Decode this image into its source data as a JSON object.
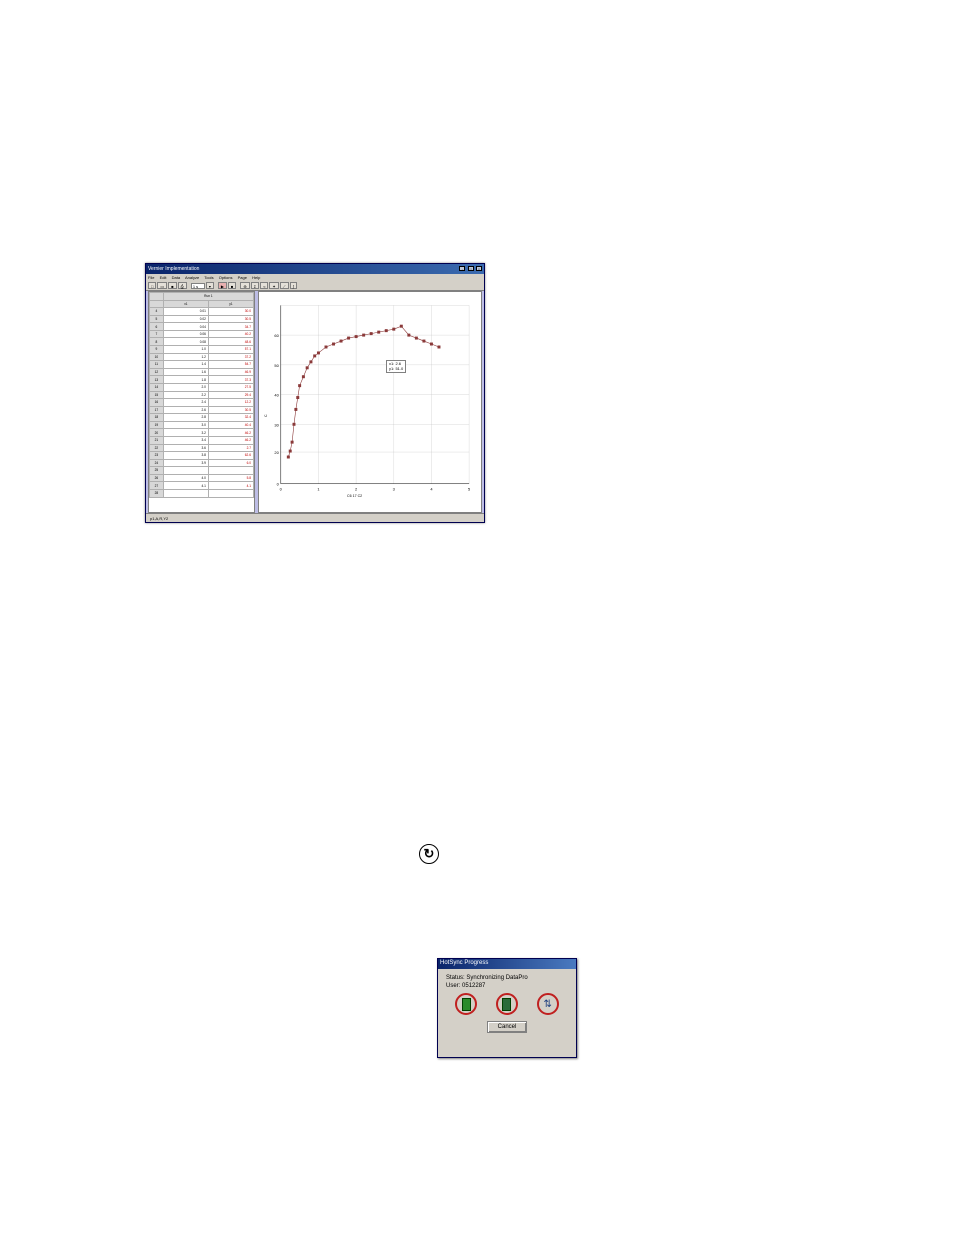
{
  "app": {
    "title": "Vernier Implementation",
    "menus": [
      "File",
      "Edit",
      "Data",
      "Analyze",
      "Tools",
      "Options",
      "Page",
      "Help"
    ],
    "toolbar": {
      "rate_value": "1 s",
      "buttons": [
        "",
        "",
        "",
        "",
        "",
        "",
        "",
        "",
        "",
        "",
        "",
        ""
      ]
    },
    "status": "p1,A,R,Y2"
  },
  "table": {
    "group_header": "Run 1",
    "col1_header": "x1",
    "col2_header": "y1",
    "rows": [
      {
        "n": "4",
        "c1": "0.01",
        "c2": "30.0"
      },
      {
        "n": "5",
        "c1": "0.02",
        "c2": "30.5"
      },
      {
        "n": "6",
        "c1": "0.04",
        "c2": "34.7"
      },
      {
        "n": "7",
        "c1": "0.06",
        "c2": "40.2"
      },
      {
        "n": "8",
        "c1": "0.08",
        "c2": "48.6"
      },
      {
        "n": "9",
        "c1": "1.0",
        "c2": "57.1"
      },
      {
        "n": "10",
        "c1": "1.2",
        "c2": "37.2"
      },
      {
        "n": "11",
        "c1": "1.4",
        "c2": "54.7"
      },
      {
        "n": "12",
        "c1": "1.6",
        "c2": "46.9"
      },
      {
        "n": "13",
        "c1": "1.8",
        "c2": "37.3"
      },
      {
        "n": "14",
        "c1": "2.0",
        "c2": "27.5"
      },
      {
        "n": "15",
        "c1": "2.2",
        "c2": "29.4"
      },
      {
        "n": "16",
        "c1": "2.4",
        "c2": "12.2"
      },
      {
        "n": "17",
        "c1": "2.6",
        "c2": "30.5"
      },
      {
        "n": "18",
        "c1": "2.8",
        "c2": "32.4"
      },
      {
        "n": "19",
        "c1": "3.0",
        "c2": "40.4"
      },
      {
        "n": "20",
        "c1": "3.2",
        "c2": "46.2"
      },
      {
        "n": "21",
        "c1": "3.4",
        "c2": "46.2"
      },
      {
        "n": "22",
        "c1": "3.6",
        "c2": "2.7"
      },
      {
        "n": "23",
        "c1": "3.8",
        "c2": "62.6"
      },
      {
        "n": "24",
        "c1": "3.9",
        "c2": "6.0"
      },
      {
        "n": "25",
        "c1": "",
        "c2": ""
      },
      {
        "n": "26",
        "c1": "4.0",
        "c2": "5.8"
      },
      {
        "n": "27",
        "c1": "4.1",
        "c2": "4.1"
      },
      {
        "n": "28",
        "c1": "",
        "c2": ""
      }
    ]
  },
  "chart_data": {
    "type": "scatter",
    "xlabel": "C6      17     C2",
    "ylabel": "C",
    "xlim": [
      0,
      5
    ],
    "ylim": [
      0,
      60
    ],
    "xticks": [
      0,
      1,
      2,
      3,
      4,
      5
    ],
    "yticks": [
      0,
      20,
      30,
      40,
      50,
      60
    ],
    "series": [
      {
        "name": "Run 1",
        "color": "#8b3a3a",
        "points": [
          [
            0.2,
            9
          ],
          [
            0.25,
            11
          ],
          [
            0.3,
            14
          ],
          [
            0.35,
            20
          ],
          [
            0.4,
            25
          ],
          [
            0.45,
            29
          ],
          [
            0.5,
            33
          ],
          [
            0.6,
            36
          ],
          [
            0.7,
            39
          ],
          [
            0.8,
            41
          ],
          [
            0.9,
            43
          ],
          [
            1.0,
            44
          ],
          [
            1.2,
            46
          ],
          [
            1.4,
            47
          ],
          [
            1.6,
            48
          ],
          [
            1.8,
            49
          ],
          [
            2.0,
            49.5
          ],
          [
            2.2,
            50
          ],
          [
            2.4,
            50.5
          ],
          [
            2.6,
            51
          ],
          [
            2.8,
            51.5
          ],
          [
            3.0,
            52
          ],
          [
            3.2,
            53
          ],
          [
            3.4,
            50
          ],
          [
            3.6,
            49
          ],
          [
            3.8,
            48
          ],
          [
            4.0,
            47
          ],
          [
            4.2,
            46
          ]
        ]
      }
    ],
    "annotation": {
      "lines": [
        "x1: 2.6",
        "y1: 51.0"
      ],
      "xpos": 2.8,
      "ypos": 41
    }
  },
  "sync_icon": {
    "glyph": "↻"
  },
  "dialog": {
    "title": "HotSync Progress",
    "status_label": "Status:",
    "status_value": "Synchronizing DataPro",
    "user_label": "User:",
    "user_value": "0512287",
    "cancel": "Cancel"
  }
}
